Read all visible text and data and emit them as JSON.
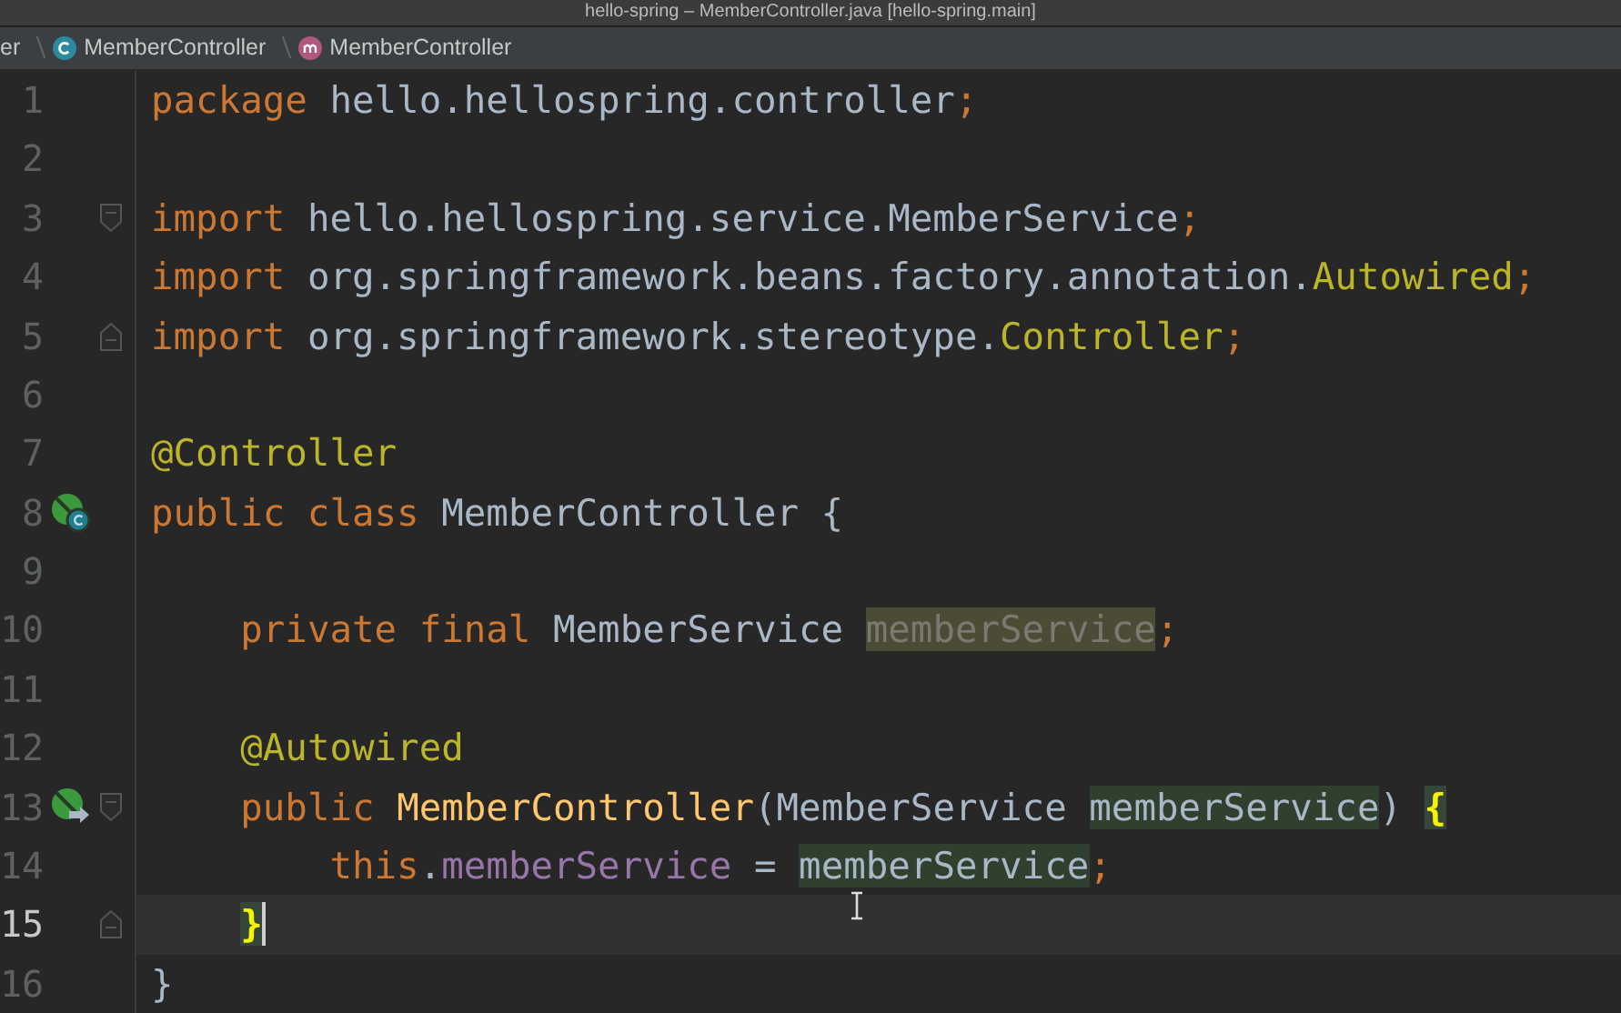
{
  "window": {
    "title": "hello-spring – MemberController.java [hello-spring.main]"
  },
  "breadcrumbs": [
    {
      "label": "er",
      "kind": "plain"
    },
    {
      "label": "MemberController",
      "kind": "class"
    },
    {
      "label": "MemberController",
      "kind": "method"
    }
  ],
  "editor": {
    "lines": [
      {
        "number": "1",
        "current": false,
        "tokens": [
          {
            "text": "package",
            "kind": "keyword"
          },
          {
            "text": " hello.hellospring.controller",
            "kind": "plain"
          },
          {
            "text": ";",
            "kind": "keyword"
          }
        ]
      },
      {
        "number": "2",
        "current": false
      },
      {
        "number": "3",
        "current": false,
        "fold_start": true,
        "tokens": [
          {
            "text": "import",
            "kind": "keyword"
          },
          {
            "text": " hello.hellospring.service.MemberService",
            "kind": "plain"
          },
          {
            "text": ";",
            "kind": "keyword"
          }
        ]
      },
      {
        "number": "4",
        "current": false,
        "tokens": [
          {
            "text": "import",
            "kind": "keyword"
          },
          {
            "text": " org.springframework.beans.factory.annotation.",
            "kind": "plain"
          },
          {
            "text": "Autowired",
            "kind": "annotation"
          },
          {
            "text": ";",
            "kind": "keyword"
          }
        ]
      },
      {
        "number": "5",
        "current": false,
        "fold_end": true,
        "tokens": [
          {
            "text": "import",
            "kind": "keyword"
          },
          {
            "text": " org.springframework.stereotype.",
            "kind": "plain"
          },
          {
            "text": "Controller",
            "kind": "annotation"
          },
          {
            "text": ";",
            "kind": "keyword"
          }
        ]
      },
      {
        "number": "6",
        "current": false
      },
      {
        "number": "7",
        "current": false,
        "tokens": [
          {
            "text": "@Controller",
            "kind": "annotation"
          }
        ]
      },
      {
        "number": "8",
        "current": false,
        "bean_marker": true,
        "tokens": [
          {
            "text": "public class",
            "kind": "keyword"
          },
          {
            "text": " MemberController {",
            "kind": "plain"
          }
        ]
      },
      {
        "number": "9",
        "current": false
      },
      {
        "number": "10",
        "current": false,
        "tokens": [
          {
            "text": "    private final",
            "kind": "keyword"
          },
          {
            "text": " MemberService ",
            "kind": "plain"
          },
          {
            "text": "memberService",
            "kind": "unused"
          },
          {
            "text": ";",
            "kind": "keyword"
          }
        ]
      },
      {
        "number": "11",
        "current": false
      },
      {
        "number": "12",
        "current": false,
        "tokens": [
          {
            "text": "    @Autowired",
            "kind": "annotation"
          }
        ]
      },
      {
        "number": "13",
        "current": false,
        "inject_marker": true,
        "fold_start": true,
        "tokens": [
          {
            "text": "    public",
            "kind": "keyword"
          },
          {
            "text": " MemberController",
            "kind": "method"
          },
          {
            "text": "(MemberService ",
            "kind": "plain"
          },
          {
            "text": "memberService",
            "kind": "reference"
          },
          {
            "text": ") ",
            "kind": "plain"
          },
          {
            "text": "{",
            "kind": "brace"
          }
        ]
      },
      {
        "number": "14",
        "current": false,
        "tokens": [
          {
            "text": "        this",
            "kind": "keyword"
          },
          {
            "text": ".",
            "kind": "plain"
          },
          {
            "text": "memberService",
            "kind": "field"
          },
          {
            "text": " = ",
            "kind": "plain"
          },
          {
            "text": "memberService",
            "kind": "reference"
          },
          {
            "text": ";",
            "kind": "keyword"
          }
        ]
      },
      {
        "number": "15",
        "current": true,
        "fold_end": true,
        "tokens": [
          {
            "text": "    }",
            "kind": "brace"
          }
        ]
      },
      {
        "number": "16",
        "current": false,
        "tokens": [
          {
            "text": "}",
            "kind": "plain"
          }
        ]
      }
    ]
  }
}
